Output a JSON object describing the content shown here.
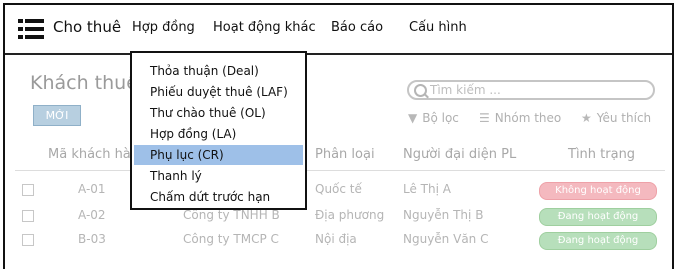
{
  "brand": "Cho thuê",
  "nav": [
    "Hợp đồng",
    "Hoạt động khác",
    "Báo cáo",
    "Cấu hình"
  ],
  "dropdown": {
    "items": [
      "Thỏa thuận (Deal)",
      "Phiếu duyệt thuê (LAF)",
      "Thư chào thuê (OL)",
      "Hợp đồng (LA)",
      "Phụ lục (CR)",
      "Thanh lý",
      "Chấm dứt trước hạn"
    ],
    "selected_index": 4,
    "selected_color": "#9ec0e8"
  },
  "page": {
    "title": "Khách thuê",
    "new_button": "MỚI",
    "search_placeholder": "Tìm kiếm ...",
    "toolbar": {
      "filter": "Bộ lọc",
      "group": "Nhóm theo",
      "favorite": "Yêu thích"
    }
  },
  "table": {
    "headers": [
      "Mã khách hà",
      "Phân loại",
      "Người đại diện PL",
      "Tình trạng"
    ],
    "rows": [
      {
        "code": "A-01",
        "company": "",
        "type": "Quốc tế",
        "rep": "Lê Thị A",
        "status": "Không hoạt động",
        "active": false
      },
      {
        "code": "A-02",
        "company": "Công ty TNHH B",
        "type": "Địa phương",
        "rep": "Nguyễn Thị B",
        "status": "Đang hoạt động",
        "active": true
      },
      {
        "code": "B-03",
        "company": "Công ty TMCP C",
        "type": "Nội địa",
        "rep": "Nguyễn Văn C",
        "status": "Đang hoạt động",
        "active": true
      }
    ]
  },
  "colors": {
    "active_badge": "#b7dfbb",
    "inactive_badge": "#f4b9bf",
    "accent": "#9ec0e8"
  }
}
